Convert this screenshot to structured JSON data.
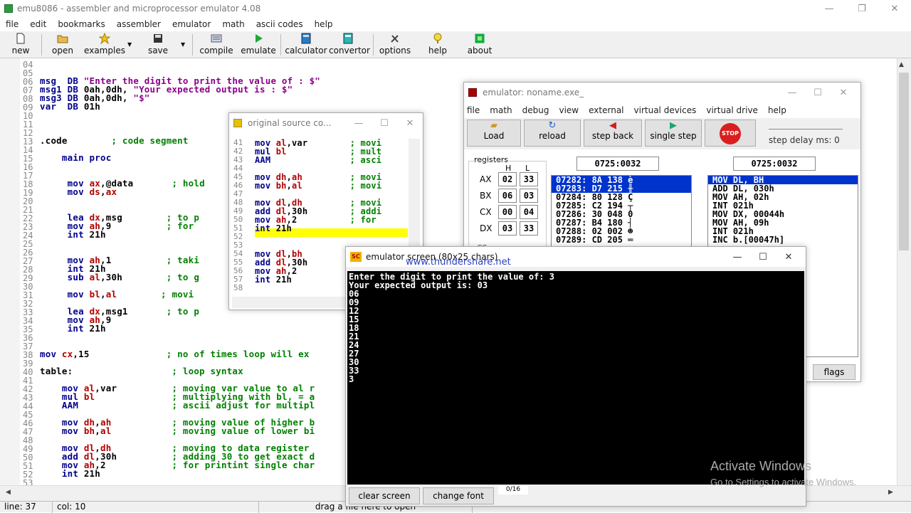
{
  "window": {
    "title": "emu8086 - assembler and microprocessor emulator 4.08",
    "min": "—",
    "max": "❐",
    "close": "✕"
  },
  "menu": [
    "file",
    "edit",
    "bookmarks",
    "assembler",
    "emulator",
    "math",
    "ascii codes",
    "help"
  ],
  "toolbar": {
    "new": "new",
    "open": "open",
    "examples": "examples",
    "save": "save",
    "compile": "compile",
    "emulate": "emulate",
    "calculator": "calculator",
    "convertor": "convertor",
    "options": "options",
    "help": "help",
    "about": "about"
  },
  "editor": {
    "line_numbers": [
      "04",
      "05",
      "06",
      "07",
      "08",
      "09",
      "10",
      "11",
      "12",
      "13",
      "14",
      "15",
      "16",
      "17",
      "18",
      "19",
      "20",
      "21",
      "22",
      "23",
      "24",
      "25",
      "26",
      "27",
      "28",
      "29",
      "30",
      "31",
      "32",
      "33",
      "34",
      "35",
      "36",
      "37",
      "38",
      "39",
      "40",
      "41",
      "42",
      "43",
      "44",
      "45",
      "46",
      "47",
      "48",
      "49",
      "50",
      "51",
      "52",
      "53"
    ]
  },
  "status": {
    "line": "line: 37",
    "col": "col: 10",
    "hint": "drag a file here to open"
  },
  "source_window": {
    "title": "original source co...",
    "lines": [
      "41",
      "42",
      "43",
      "44",
      "45",
      "46",
      "47",
      "48",
      "49",
      "50",
      "51",
      "52",
      "53",
      "54",
      "55",
      "56",
      "57",
      "58"
    ]
  },
  "emulator_window": {
    "title": "emulator: noname.exe_",
    "menu": [
      "file",
      "math",
      "debug",
      "view",
      "external",
      "virtual devices",
      "virtual drive",
      "help"
    ],
    "buttons": {
      "load": "Load",
      "reload": "reload",
      "step_back": "step back",
      "single_step": "single step",
      "stop": "STOP"
    },
    "step_delay": "step delay ms: 0",
    "registers_label": "registers",
    "h": "H",
    "l": "L",
    "regs": [
      {
        "name": "AX",
        "h": "02",
        "l": "33"
      },
      {
        "name": "BX",
        "h": "06",
        "l": "03"
      },
      {
        "name": "CX",
        "h": "00",
        "l": "04"
      },
      {
        "name": "DX",
        "h": "03",
        "l": "33"
      }
    ],
    "cs_partial": "CS",
    "addr1": "0725:0032",
    "addr2": "0725:0032",
    "mem": [
      "07282: 8A 138 è",
      "07283: D7 215 ╫",
      "07284: 80 128 Ç",
      "07285: C2 194 ┬",
      "07286: 30 048 0",
      "07287: B4 180 ┤",
      "07288: 02 002 ☻",
      "07289: CD 205 ═"
    ],
    "dis": [
      "MOV DL, BH",
      "ADD DL, 030h",
      "MOV AH, 02h",
      "INT 021h",
      "MOV DX, 00044h",
      "MOV AH, 09h",
      "INT 021h",
      "INC b.[00047h]"
    ],
    "flags": "flags"
  },
  "screen_window": {
    "title": "emulator screen (80x25 chars)",
    "watermark": "www.thundershare.net",
    "output": [
      "Enter the digit to print the value of: 3",
      "Your expected output is: 03",
      "06",
      "09",
      "12",
      "15",
      "18",
      "21",
      "24",
      "27",
      "30",
      "33",
      "3"
    ],
    "clear": "clear screen",
    "font": "change font",
    "counter": "0/16"
  },
  "activate": {
    "title": "Activate Windows",
    "sub": "Go to Settings to activate Windows."
  }
}
